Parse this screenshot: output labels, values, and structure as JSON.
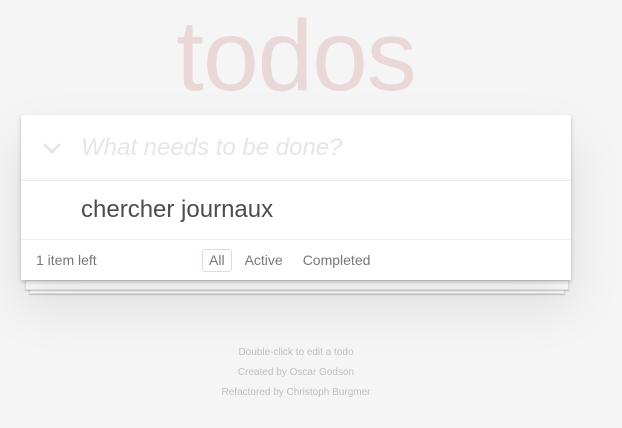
{
  "app": {
    "title": "todos"
  },
  "new_todo": {
    "placeholder": "What needs to be done?",
    "value": "",
    "toggle_icon": "chevron-down-icon"
  },
  "todos": [
    {
      "label": "chercher journaux",
      "completed": false
    }
  ],
  "footer": {
    "count_text": "1 item left",
    "filters": [
      {
        "label": "All",
        "selected": true
      },
      {
        "label": "Active",
        "selected": false
      },
      {
        "label": "Completed",
        "selected": false
      }
    ]
  },
  "info": {
    "line1": "Double-click to edit a todo",
    "line2": "Created by Oscar Godson",
    "line3": "Refactored by Christoph Burgmer"
  },
  "colors": {
    "background": "#f5f5f5",
    "title": "rgba(175,47,47,0.15)",
    "text": "#4d4d4d",
    "selected_filter_border": "rgba(175,47,47,0.2)"
  }
}
